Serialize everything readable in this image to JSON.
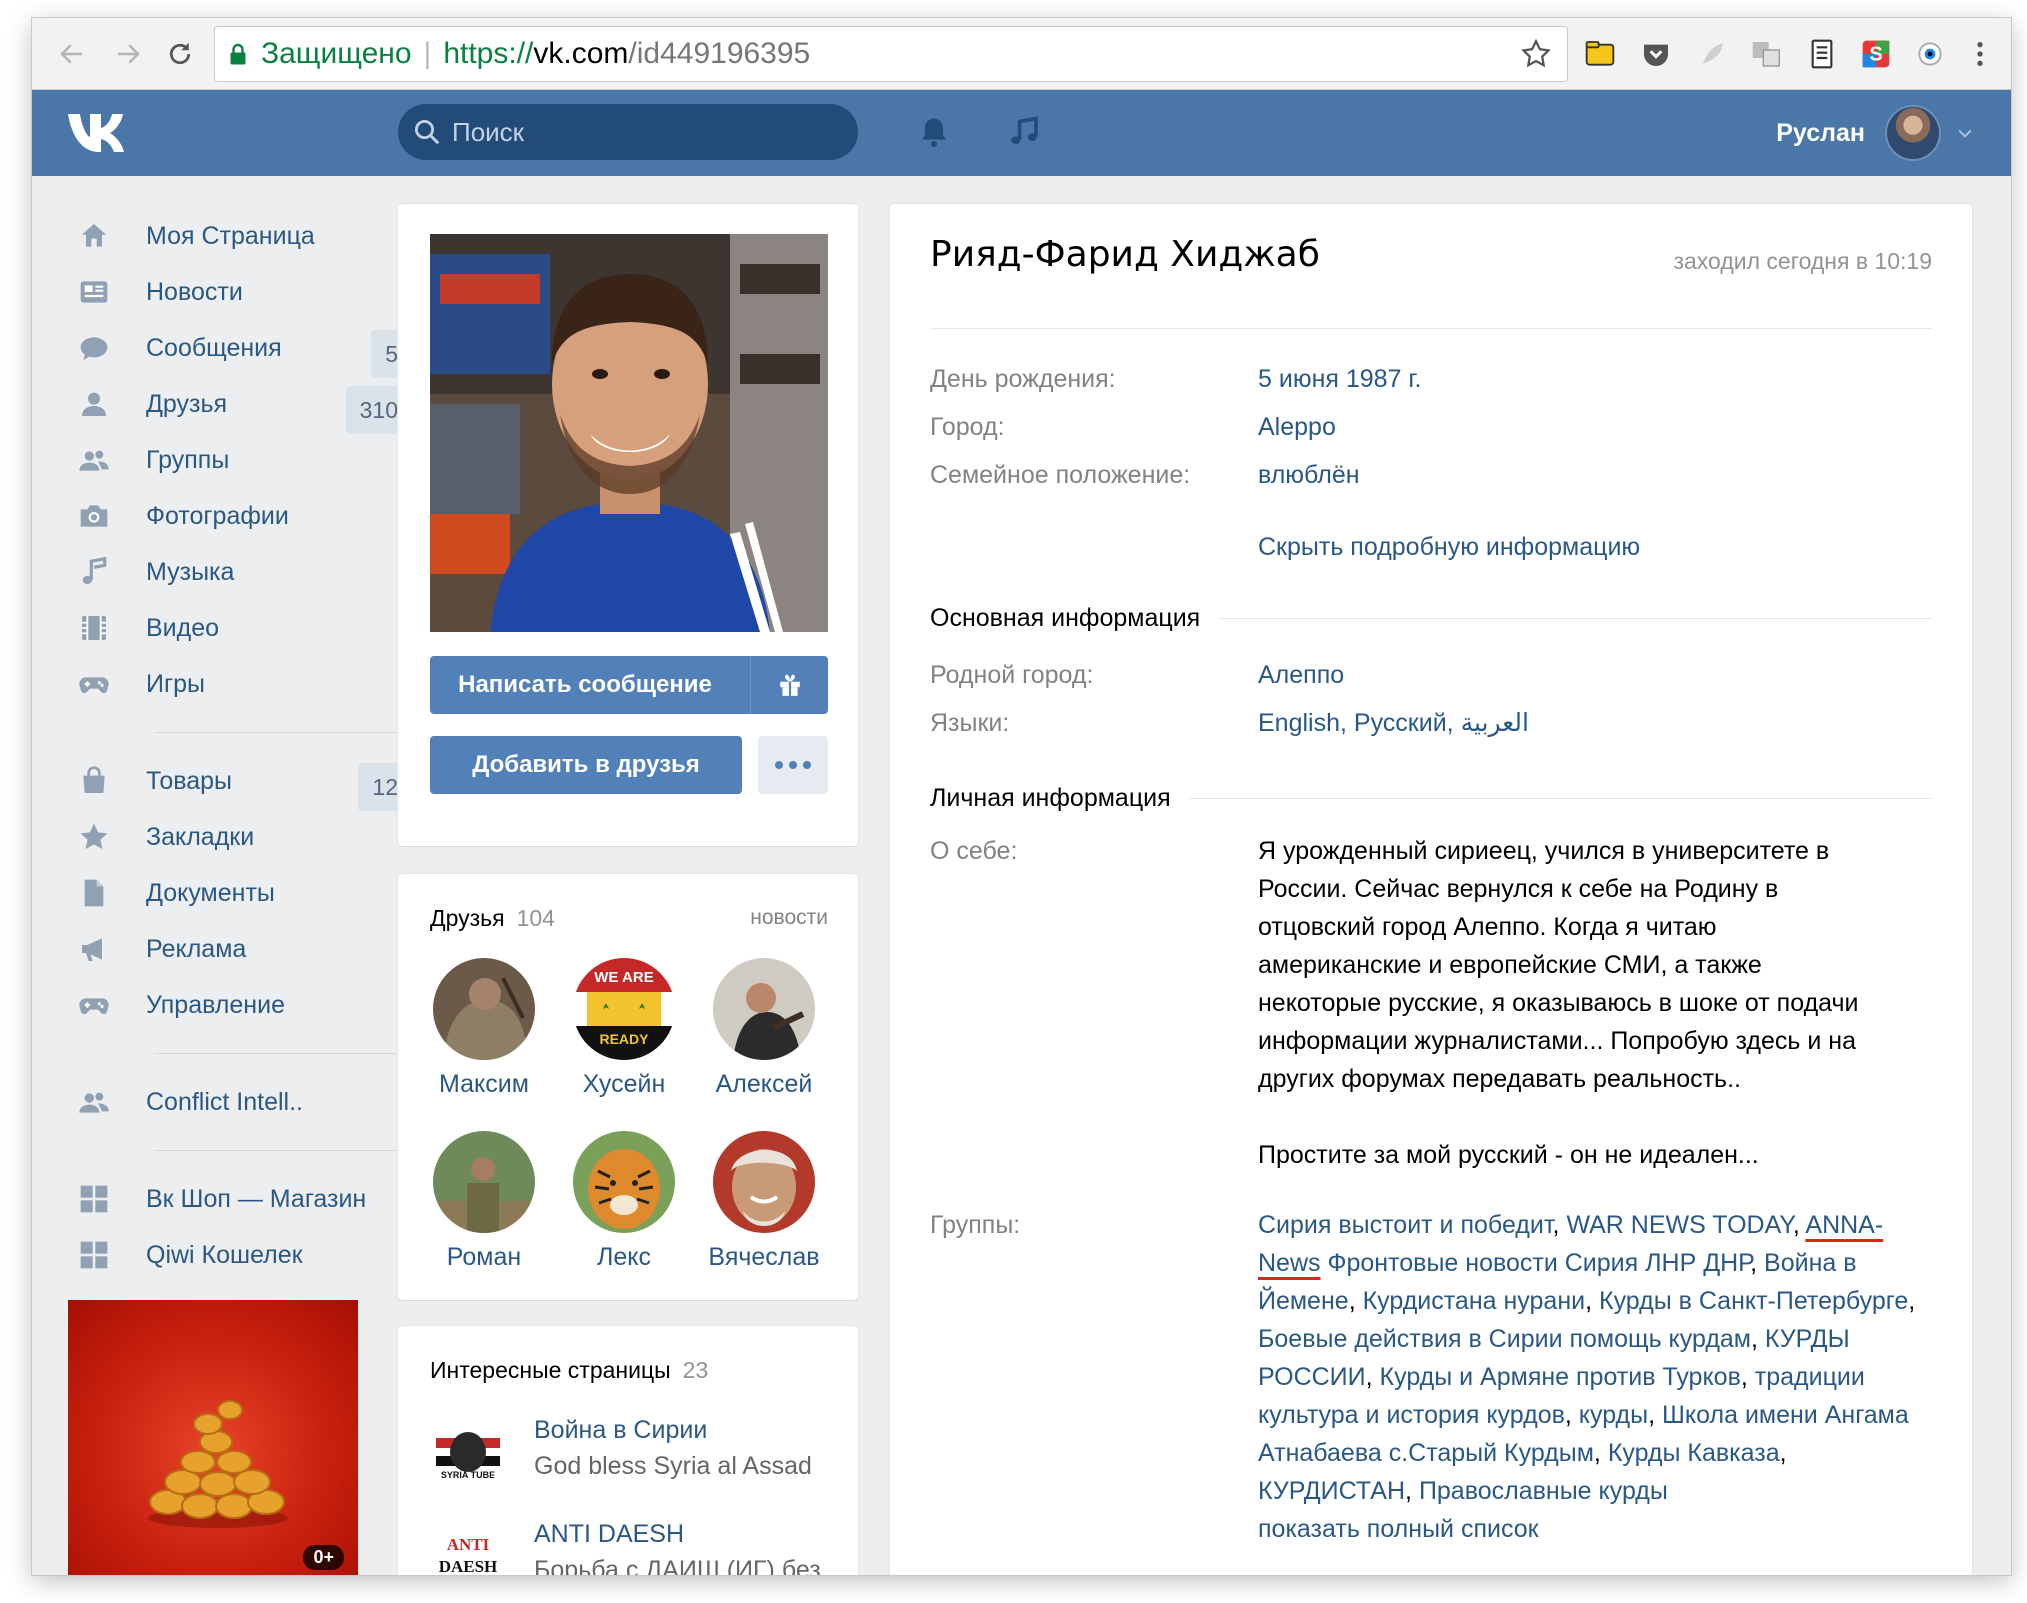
{
  "browser": {
    "secure_label": "Защищено",
    "url_scheme": "https://",
    "url_host": "vk.com",
    "url_path": "/id449196395"
  },
  "header": {
    "search_placeholder": "Поиск",
    "user_name": "Руслан"
  },
  "nav": {
    "items": [
      {
        "label": "Моя Страница",
        "icon": "home-icon"
      },
      {
        "label": "Новости",
        "icon": "news-icon"
      },
      {
        "label": "Сообщения",
        "icon": "messages-icon",
        "count": "5"
      },
      {
        "label": "Друзья",
        "icon": "friends-icon",
        "count": "310"
      },
      {
        "label": "Группы",
        "icon": "groups-icon"
      },
      {
        "label": "Фотографии",
        "icon": "camera-icon"
      },
      {
        "label": "Музыка",
        "icon": "music-icon"
      },
      {
        "label": "Видео",
        "icon": "video-icon"
      },
      {
        "label": "Игры",
        "icon": "gamepad-icon"
      }
    ],
    "items2": [
      {
        "label": "Товары",
        "icon": "bag-icon",
        "count": "12"
      },
      {
        "label": "Закладки",
        "icon": "star-icon"
      },
      {
        "label": "Документы",
        "icon": "document-icon"
      },
      {
        "label": "Реклама",
        "icon": "megaphone-icon"
      },
      {
        "label": "Управление",
        "icon": "gamepad-icon"
      }
    ],
    "items3": [
      {
        "label": "Conflict Intell..",
        "icon": "groups-icon"
      }
    ],
    "items4": [
      {
        "label": "Вк Шоп — Магазин",
        "icon": "apps-icon"
      },
      {
        "label": "Qiwi Кошелек",
        "icon": "apps-icon"
      }
    ],
    "ad_age": "0+"
  },
  "profile": {
    "send_message": "Написать сообщение",
    "add_friend": "Добавить в друзья"
  },
  "friends": {
    "title": "Друзья",
    "count": "104",
    "link": "новости",
    "list": [
      "Максим",
      "Хусейн",
      "Алексей",
      "Роман",
      "Лекс",
      "Вячеслав"
    ]
  },
  "pages": {
    "title": "Интересные страницы",
    "count": "23",
    "list": [
      {
        "name": "Война в Сирии",
        "desc": "God bless Syria al Assad"
      },
      {
        "name": "ANTI DAESH",
        "desc": "Борьба с ДАИШ (ИГ) без"
      }
    ]
  },
  "info": {
    "name": "Рияд-Фарид Хиджаб",
    "online": "заходил сегодня в 10:19",
    "birthday_label": "День рождения:",
    "birthday": "5 июня 1987 г.",
    "city_label": "Город:",
    "city": "Aleppo",
    "family_label": "Семейное положение:",
    "family": "влюблён",
    "hide_details": "Скрыть подробную информацию",
    "main_section": "Основная информация",
    "hometown_label": "Родной город:",
    "hometown": "Алеппо",
    "languages_label": "Языки:",
    "lang1": "English",
    "lang2": "Русский",
    "lang3": "العربية",
    "personal_section": "Личная информация",
    "about_label": "О себе:",
    "about_lines": [
      "Я урожденный сириеец, учился в университете в",
      "России. Сейчас вернулся к себе на Родину в",
      "отцовский город Алеппо. Когда я читаю",
      "американские и европейские СМИ, а также",
      "некоторые русские, я оказываюсь в шоке от подачи",
      "информации журналистами... Попробую здесь и на",
      "других форумах передавать реальность.."
    ],
    "about_line2": "Простите за мой русский - он не идеален...",
    "groups_label": "Группы:",
    "show_full_list": "показать полный список"
  },
  "groups": [
    "Сирия выстоит и победит",
    "WAR NEWS TODAY",
    "ANNA-News",
    "Фронтовые новости Сирия ЛНР ДНР",
    "Война в Йемене",
    "Курдистана нурани",
    "Курды в Санкт-Петербурге",
    "Боевые действия в Сирии помощь курдам",
    "КУРДЫ РОССИИ",
    "Курды и Армяне против Турков",
    "традиции культура и история курдов",
    "курды",
    "Школа имени Ангама Атнабаева с.Старый Курдым",
    "Курды Кавказа",
    "КУРДИСТАН",
    "Православные курды"
  ],
  "colors": {
    "vk_blue": "#4a76a8",
    "link": "#2a5885",
    "button": "#5181b8",
    "annotation_red": "#e0261a"
  }
}
